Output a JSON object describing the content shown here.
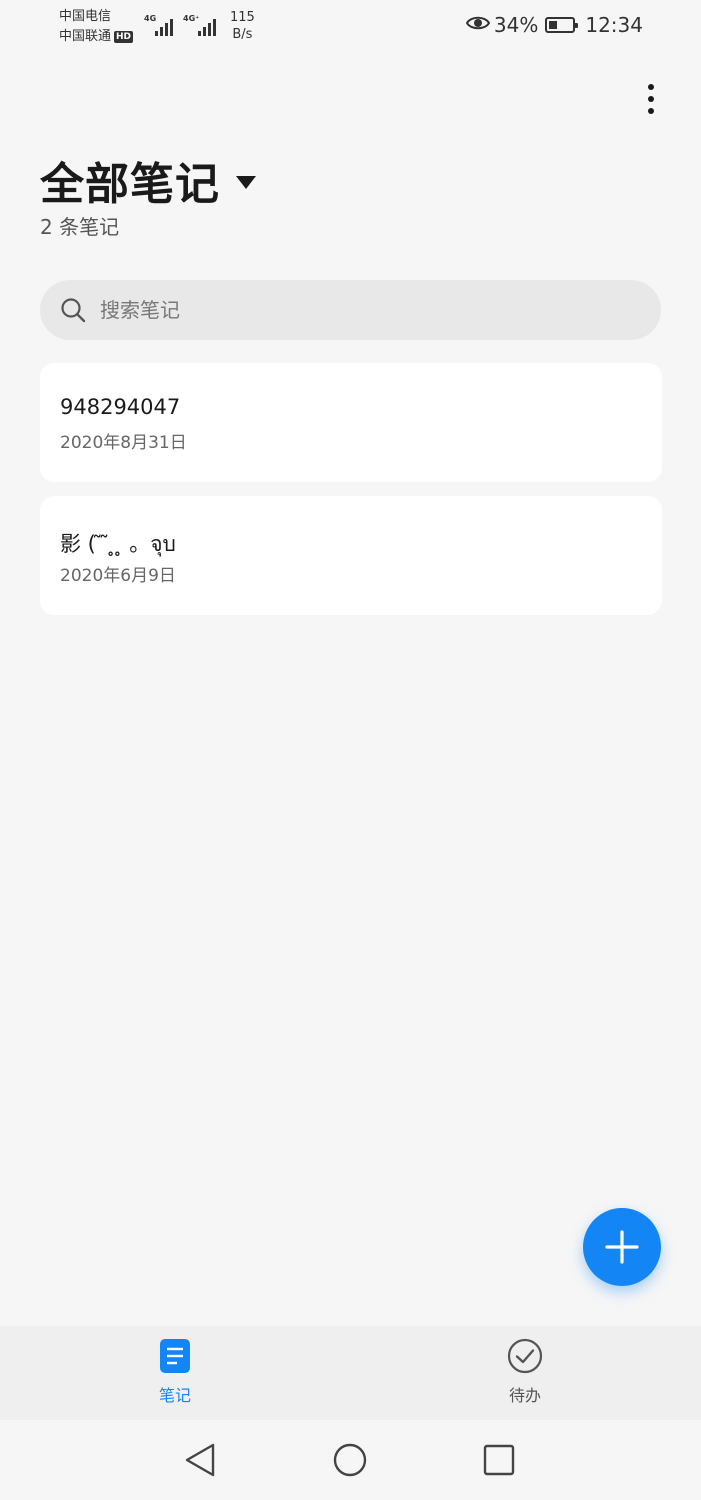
{
  "status_bar": {
    "carrier_1": "中国电信",
    "carrier_2": "中国联通",
    "carrier_2_badge": "HD",
    "signal_1_label": "4G",
    "signal_2_label": "4G⁺",
    "net_speed_value": "115",
    "net_speed_unit": "B/s",
    "battery_percent": "34%",
    "battery_level": 0.34,
    "time": "12:34",
    "icons": [
      "eye-icon",
      "battery-icon"
    ]
  },
  "header": {
    "title": "全部笔记",
    "count": "2 条笔记",
    "menu_icon": "more-vertical-icon"
  },
  "search": {
    "placeholder": "搜索笔记",
    "value": "",
    "icon": "search-icon"
  },
  "notes": [
    {
      "title": "948294047",
      "date": "2020年8月31日"
    },
    {
      "title": "影 ( ̃ ̃ ̥ ̥ 。จุบ",
      "date": "2020年6月9日"
    }
  ],
  "fab": {
    "icon": "plus-icon"
  },
  "bottom_nav": {
    "tabs": [
      {
        "label": "笔记",
        "icon": "note-icon",
        "active": true
      },
      {
        "label": "待办",
        "icon": "check-circle-icon",
        "active": false
      }
    ],
    "active_color": "#1485f5",
    "inactive_color": "#555555"
  },
  "system_nav": {
    "buttons": [
      "back-triangle-icon",
      "home-circle-icon",
      "recents-square-icon"
    ]
  },
  "colors": {
    "accent": "#1485f5",
    "background": "#f6f6f6",
    "card": "#ffffff"
  }
}
